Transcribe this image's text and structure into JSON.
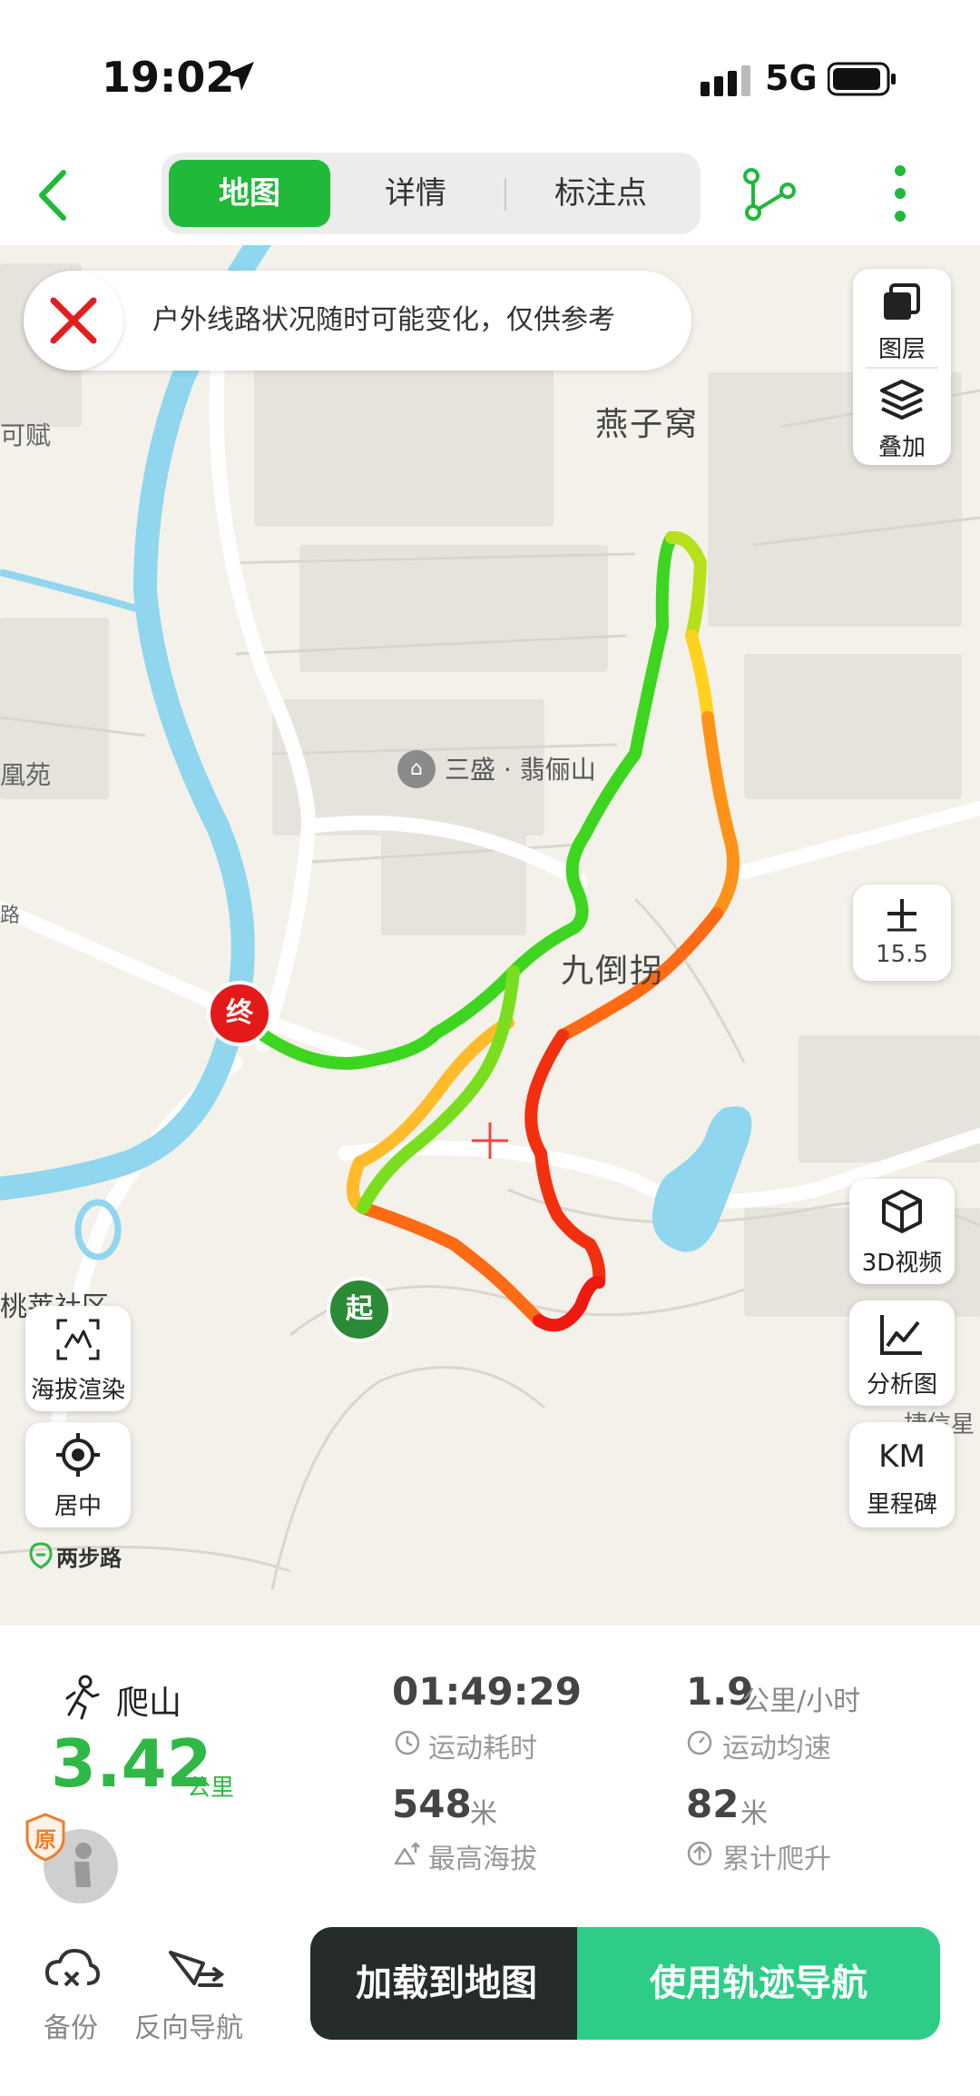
{
  "status_bar": {
    "time": "19:02",
    "network": "5G"
  },
  "nav": {
    "tabs": [
      {
        "label": "地图",
        "active": true
      },
      {
        "label": "详情",
        "active": false
      },
      {
        "label": "标注点",
        "active": false
      }
    ]
  },
  "map": {
    "notice": "户外线路状况随时可能变化，仅供参考",
    "labels": {
      "yanziwo": "燕子窝",
      "sansheng": "三盛 · 翡俪山",
      "jiudaoguai": "九倒拐",
      "kefu": "可赋",
      "fenghuangyuan": "凰苑",
      "lu": "路",
      "taolai": "桃莱社区",
      "jiexin": "捷信星",
      "brand": "两步路"
    },
    "markers": {
      "start": "起",
      "end": "终"
    },
    "buttons": {
      "layers": "图层",
      "overlay": "叠加",
      "zoom_level": "15.5",
      "elevation_render": "海拔渲染",
      "center": "居中",
      "video_3d": "3D视频",
      "analysis": "分析图",
      "km_icon": "KM",
      "milestone": "里程碑"
    },
    "colors": {
      "track_start": "#2fd12a",
      "track_high": "#f21a0f",
      "water": "#8fd6ee",
      "road": "#ffffff"
    }
  },
  "stats": {
    "activity": "爬山",
    "distance": "3.42",
    "distance_unit": "公里",
    "badge": "原",
    "duration": "01:49:29",
    "duration_label": "运动耗时",
    "avg_speed": "1.9",
    "avg_speed_unit": "公里/小时",
    "avg_speed_label": "运动均速",
    "max_alt": "548",
    "max_alt_unit": "米",
    "max_alt_label": "最高海拔",
    "climb": "82",
    "climb_unit": "米",
    "climb_label": "累计爬升"
  },
  "bottom": {
    "backup": "备份",
    "reverse_nav": "反向导航",
    "load_map": "加载到地图",
    "track_nav": "使用轨迹导航"
  }
}
